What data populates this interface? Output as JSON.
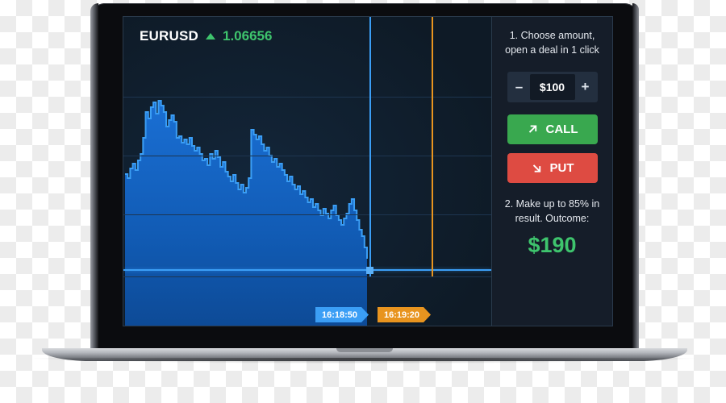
{
  "chart_panel": {
    "symbol": "EURUSD",
    "direction_icon": "triangle-up-icon",
    "price": "1.06656",
    "price_color": "#3ec46d",
    "time_markers": [
      {
        "label": "16:18:50",
        "color": "#3b9ef5",
        "name": "current-time-marker"
      },
      {
        "label": "16:19:20",
        "color": "#e8941f",
        "name": "expiry-time-marker"
      }
    ]
  },
  "side_panel": {
    "step1_hint": "1. Choose amount, open a deal in 1 click",
    "stepper": {
      "decrease_label": "–",
      "amount": "$100",
      "increase_label": "+"
    },
    "call_button": {
      "label": "CALL",
      "icon": "arrow-up-right-icon",
      "color": "#39a84f"
    },
    "put_button": {
      "label": "PUT",
      "icon": "arrow-down-right-icon",
      "color": "#de4b42"
    },
    "step2_hint": "2. Make up to 85% in result. Outcome:",
    "outcome_value": "$190",
    "outcome_color": "#3ec46d"
  },
  "chart_data": {
    "type": "area",
    "title": "EURUSD",
    "xlabel": "",
    "ylabel": "",
    "grid": true,
    "legend": false,
    "series": [
      {
        "name": "EURUSD price",
        "line_color": "#3b9ef5",
        "fill_color": "#1461c0",
        "x": [
          0,
          1,
          2,
          3,
          4,
          5,
          6,
          7,
          8,
          9,
          10,
          11,
          12,
          13,
          14,
          15,
          16,
          17,
          18,
          19,
          20,
          21,
          22,
          23,
          24,
          25,
          26,
          27,
          28,
          29,
          30,
          31,
          32,
          33,
          34,
          35,
          36,
          37,
          38,
          39,
          40,
          41,
          42,
          43,
          44,
          45,
          46,
          47,
          48,
          49,
          50,
          51,
          52,
          53,
          54,
          55,
          56,
          57,
          58,
          59,
          60,
          61,
          62,
          63,
          64,
          65,
          66,
          67,
          68,
          69,
          70,
          71,
          72,
          73,
          74,
          75,
          76,
          77,
          78,
          79,
          80,
          81,
          82,
          83,
          84,
          85,
          86,
          87,
          88,
          89,
          90,
          91,
          92,
          93,
          94
        ],
        "y": [
          195,
          200,
          188,
          182,
          190,
          178,
          170,
          150,
          118,
          126,
          112,
          106,
          120,
          104,
          110,
          118,
          136,
          128,
          122,
          130,
          150,
          148,
          156,
          152,
          158,
          150,
          160,
          166,
          162,
          170,
          178,
          176,
          184,
          170,
          176,
          166,
          174,
          186,
          180,
          192,
          198,
          204,
          196,
          206,
          214,
          208,
          218,
          212,
          200,
          140,
          146,
          152,
          148,
          158,
          166,
          162,
          172,
          180,
          176,
          186,
          182,
          190,
          196,
          204,
          198,
          208,
          214,
          210,
          220,
          216,
          224,
          230,
          226,
          236,
          232,
          240,
          246,
          238,
          244,
          250,
          240,
          234,
          246,
          252,
          258,
          250,
          244,
          232,
          226,
          240,
          252,
          264,
          272,
          286,
          300
        ]
      }
    ],
    "horizontal_price_line": {
      "value_y": 314,
      "color": "#3b9ef5"
    },
    "vertical_lines": [
      {
        "x": 305,
        "color": "#3b9ef5",
        "label": "16:18:50"
      },
      {
        "x": 383,
        "color": "#e8941f",
        "label": "16:19:20"
      }
    ],
    "gridlines_y": [
      99,
      172,
      245,
      322
    ],
    "ylim": [
      0,
      385
    ]
  }
}
